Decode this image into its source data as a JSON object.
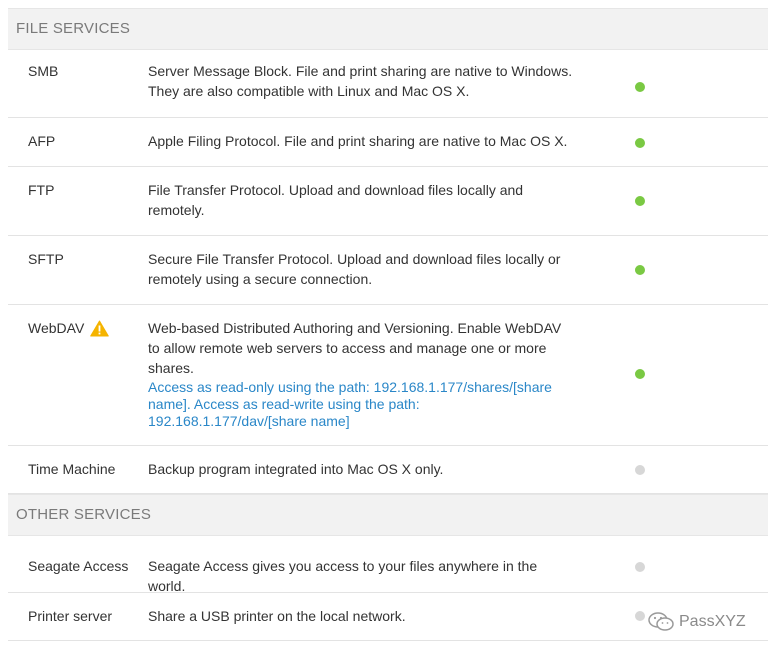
{
  "sections": [
    {
      "header": "FILE SERVICES"
    },
    {
      "header": "OTHER SERVICES"
    }
  ],
  "services": {
    "smb": {
      "name": "SMB",
      "desc": "Server Message Block. File and print sharing are native to Windows. They are also compatible with Linux and Mac OS X.",
      "status": "on"
    },
    "afp": {
      "name": "AFP",
      "desc": "Apple Filing Protocol. File and print sharing are native to Mac OS X.",
      "status": "on"
    },
    "ftp": {
      "name": "FTP",
      "desc": "File Transfer Protocol. Upload and download files locally and remotely.",
      "status": "on"
    },
    "sftp": {
      "name": "SFTP",
      "desc": "Secure File Transfer Protocol. Upload and download files locally or remotely using a secure connection.",
      "status": "on"
    },
    "webdav": {
      "name": "WebDAV",
      "desc": "Web-based Distributed Authoring and Versioning. Enable WebDAV to allow remote web servers to access and manage one or more shares.",
      "link": "Access as read-only using the path: 192.168.1.177/shares/[share name]. Access as read-write using the path: 192.168.1.177/dav/[share name]",
      "status": "on",
      "icon": "warning-icon"
    },
    "time_machine": {
      "name": "Time Machine",
      "desc": "Backup program integrated into Mac OS X only.",
      "status": "off"
    },
    "seagate_access": {
      "name": "Seagate Access",
      "desc": "Seagate Access gives you access to your files anywhere in the world.",
      "status": "off"
    },
    "printer_server": {
      "name": "Printer server",
      "desc": "Share a USB printer on the local network.",
      "status": "off"
    }
  },
  "colors": {
    "status_on": "#7ac943",
    "status_off": "#d7d7d7",
    "link": "#2a87c8",
    "warning": "#f5b400"
  },
  "watermark": {
    "text": "PassXYZ",
    "icon": "wechat-logo-icon"
  }
}
